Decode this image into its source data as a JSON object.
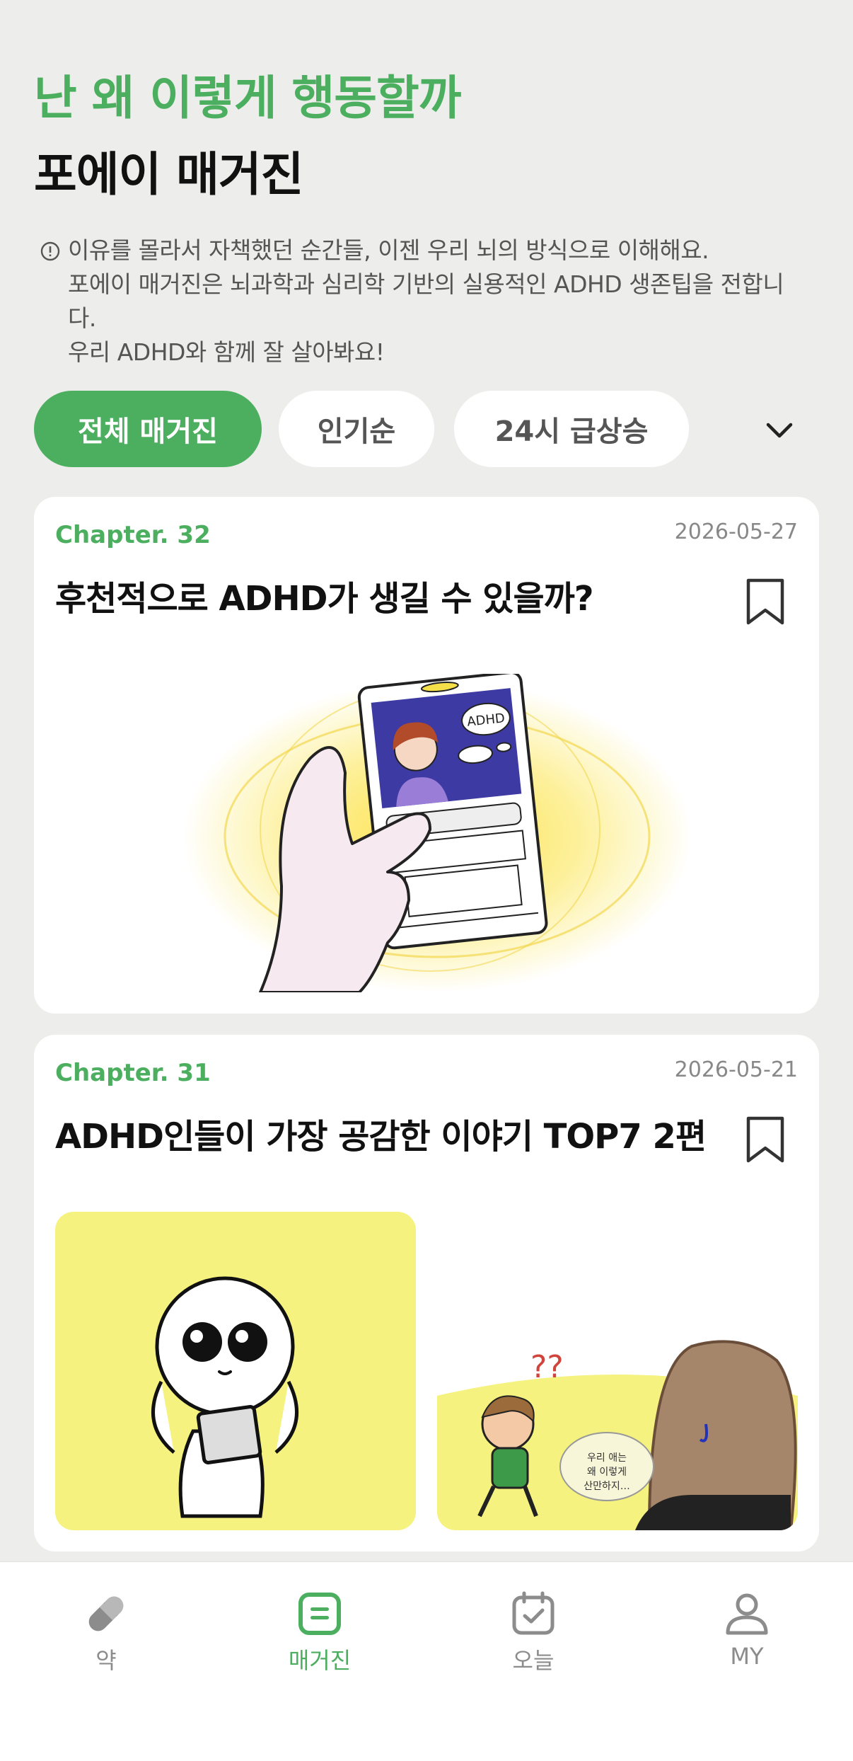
{
  "header": {
    "subtitle": "난 왜 이렇게 행동할까",
    "title": "포에이 매거진"
  },
  "description": {
    "line1": "이유를 몰라서 자책했던 순간들, 이젠 우리 뇌의 방식으로 이해해요.",
    "line2": "포에이 매거진은 뇌과학과 심리학 기반의 실용적인 ADHD 생존팁을 전합니",
    "line3": "다.",
    "line4": "우리 ADHD와 함께 잘 살아봐요!"
  },
  "filters": {
    "items": [
      {
        "label": "전체 매거진",
        "active": true
      },
      {
        "label": "인기순",
        "active": false
      },
      {
        "label": "24시 급상승",
        "active": false
      }
    ]
  },
  "articles": [
    {
      "chapter": "Chapter. 32",
      "date": "2026-05-27",
      "title": "후천적으로 ADHD가 생길 수 있을까?",
      "illustration_text": "ADHD"
    },
    {
      "chapter": "Chapter. 31",
      "date": "2026-05-21",
      "title": "ADHD인들이 가장 공감한 이야기 TOP7 2편",
      "illustration_text": "우리 애는 왜 이렇게 산만하지…"
    }
  ],
  "tabbar": {
    "items": [
      {
        "label": "약",
        "icon": "pill-icon"
      },
      {
        "label": "매거진",
        "icon": "magazine-icon",
        "active": true
      },
      {
        "label": "오늘",
        "icon": "calendar-check-icon"
      },
      {
        "label": "MY",
        "icon": "person-icon"
      }
    ]
  },
  "colors": {
    "accent": "#4caf5f",
    "background": "#ededeb",
    "card": "#ffffff"
  }
}
